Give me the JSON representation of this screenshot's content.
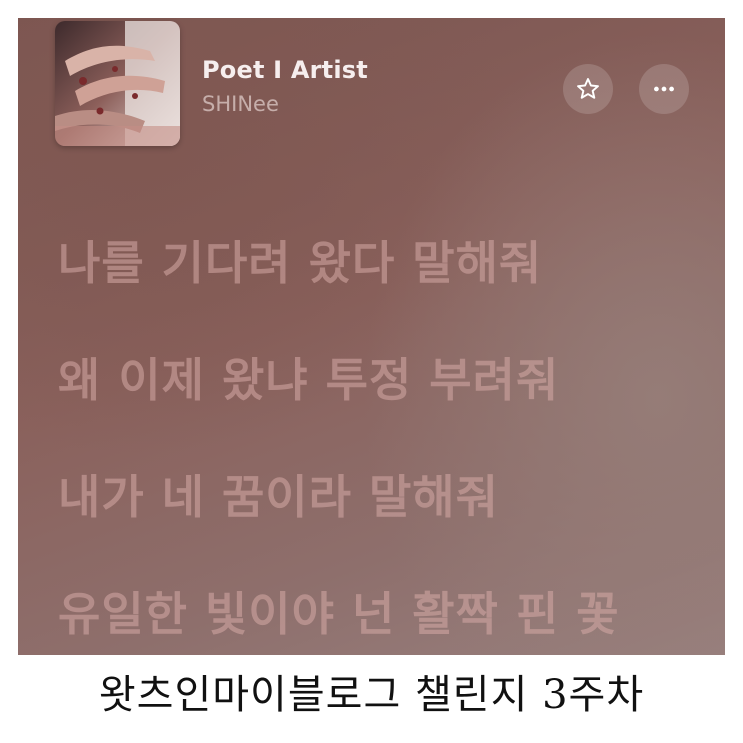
{
  "player": {
    "song_title": "Poet I Artist",
    "artist": "SHINee",
    "favorite_icon": "star-icon",
    "more_icon": "ellipsis-icon",
    "background_color": "#8a615c",
    "lyric_color": "#d6aaa5"
  },
  "lyrics": {
    "lines": [
      "나를 기다려 왔다 말해줘",
      "왜 이제 왔냐 투정 부려줘",
      "내가 네 꿈이라 말해줘",
      "유일한 빛이야 넌 활짝 핀 꽃"
    ]
  },
  "caption": {
    "text": "왓츠인마이블로그 챌린지 3주차"
  }
}
